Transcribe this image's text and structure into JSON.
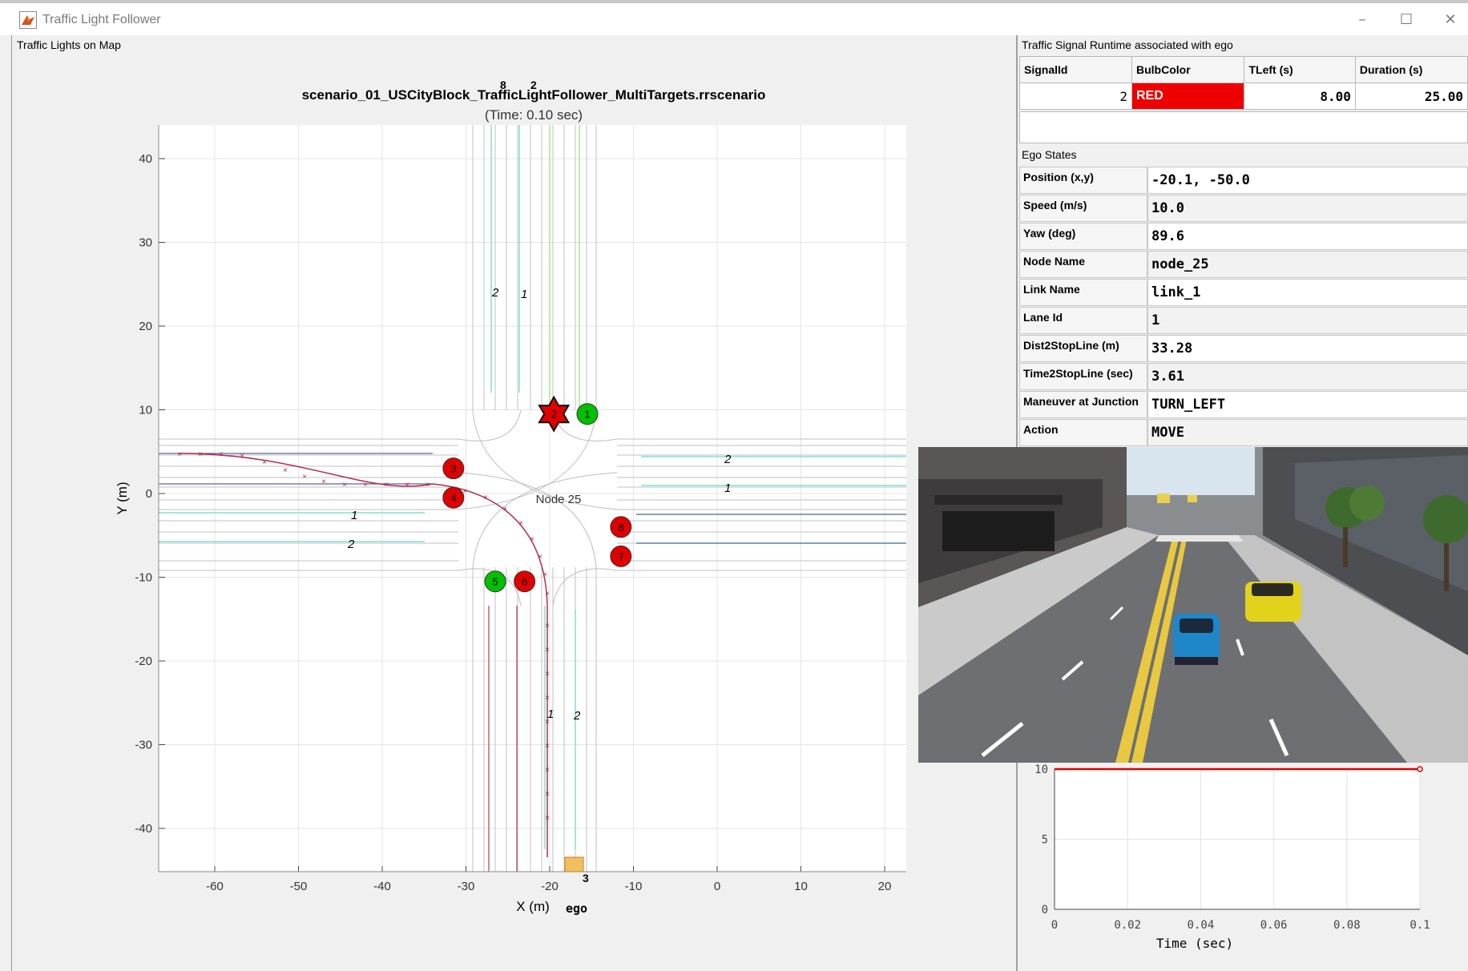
{
  "window": {
    "title": "Traffic Light Follower",
    "minimize_glyph": "–",
    "maximize_glyph": "☐",
    "close_glyph": "✕",
    "icon": "matlab-icon"
  },
  "map_panel": {
    "panel_title": "Traffic Lights on Map",
    "plot_title": "scenario_01_USCityBlock_TrafficLightFollower_MultiTargets.rrscenario",
    "plot_subtitle": "(Time: 0.10 sec)",
    "xlabel": "X (m)",
    "ylabel": "Y (m)",
    "x_ticks": [
      "-60",
      "-50",
      "-40",
      "-30",
      "-20",
      "-10",
      "0",
      "10",
      "20"
    ],
    "y_ticks": [
      "40",
      "30",
      "20",
      "10",
      "0",
      "-10",
      "-20",
      "-30",
      "-40"
    ],
    "node_label": "Node 25",
    "ego_label": "ego",
    "actor_labels": [
      "8",
      "2",
      "3"
    ],
    "lane_numbers": [
      "2",
      "1",
      "2",
      "1",
      "1",
      "2",
      "1",
      "2"
    ],
    "signals": [
      {
        "id": "1",
        "color": "#00c000",
        "x": -15.5,
        "y": 9.5
      },
      {
        "id": "2",
        "color": "#e00000",
        "x": -19.5,
        "y": 9.5,
        "highlight": true
      },
      {
        "id": "3",
        "color": "#e00000",
        "x": -31.5,
        "y": 3.0
      },
      {
        "id": "4",
        "color": "#e00000",
        "x": -31.5,
        "y": -0.5
      },
      {
        "id": "5",
        "color": "#00c000",
        "x": -26.5,
        "y": -10.5
      },
      {
        "id": "6",
        "color": "#e00000",
        "x": -23.0,
        "y": -10.5
      },
      {
        "id": "7",
        "color": "#e00000",
        "x": -11.5,
        "y": -7.5
      },
      {
        "id": "8",
        "color": "#e00000",
        "x": -11.5,
        "y": -4.0
      }
    ]
  },
  "signal_panel": {
    "panel_title": "Traffic Signal Runtime associated with ego",
    "columns": [
      "SignalId",
      "BulbColor",
      "TLeft (s)",
      "Duration (s)"
    ],
    "row": {
      "signal_id": "2",
      "bulb_color": "RED",
      "t_left": "8.00",
      "duration": "25.00"
    },
    "bulb_bg": "#ee0000"
  },
  "ego_panel": {
    "panel_title": "Ego States",
    "rows": [
      {
        "label": "Position (x,y)",
        "value": "-20.1, -50.0"
      },
      {
        "label": "Speed (m/s)",
        "value": "10.0"
      },
      {
        "label": "Yaw (deg)",
        "value": "89.6"
      },
      {
        "label": "Node Name",
        "value": "node_25"
      },
      {
        "label": "Link Name",
        "value": "link_1"
      },
      {
        "label": "Lane Id",
        "value": "1"
      },
      {
        "label": "Dist2StopLine (m)",
        "value": "33.28"
      },
      {
        "label": "Time2StopLine (sec)",
        "value": "3.61"
      },
      {
        "label": "Maneuver at Junction",
        "value": "TURN_LEFT"
      },
      {
        "label": "Action",
        "value": "MOVE"
      }
    ]
  },
  "speed_plot": {
    "xlabel": "Time (sec)",
    "x_ticks": [
      "0",
      "0.02",
      "0.04",
      "0.06",
      "0.08",
      "0.1"
    ],
    "y_ticks": [
      "10",
      "5",
      "0"
    ]
  },
  "chart_data": {
    "type": "line",
    "title": "",
    "xlabel": "Time (sec)",
    "ylabel": "",
    "x": [
      0,
      0.1
    ],
    "series": [
      {
        "values": [
          10,
          10
        ]
      }
    ],
    "xlim": [
      0,
      0.1
    ],
    "ylim": [
      0,
      10
    ],
    "grid": true,
    "line_color": "#e00000"
  }
}
